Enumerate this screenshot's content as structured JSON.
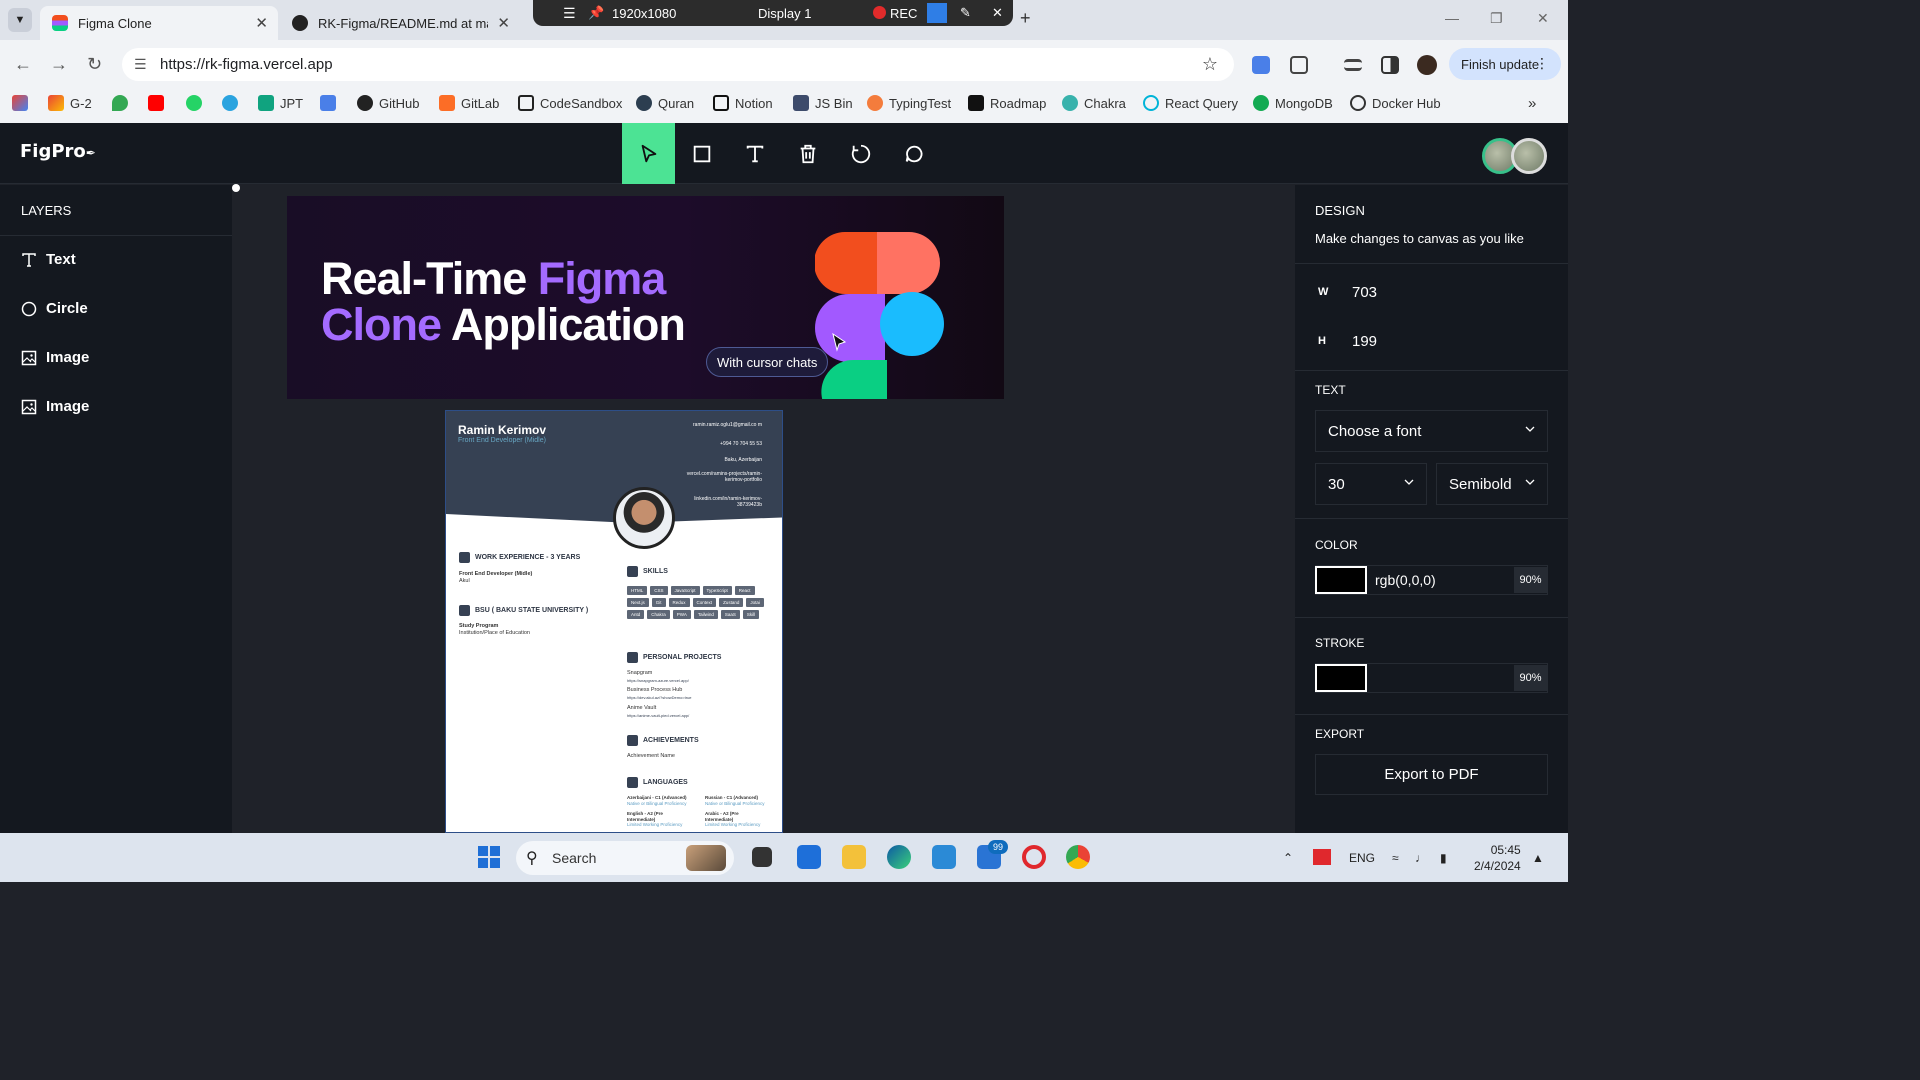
{
  "browser": {
    "tabs": [
      {
        "title": "Figma Clone",
        "active": true
      },
      {
        "title": "RK-Figma/README.md at main",
        "active": false
      }
    ],
    "recorder": {
      "resolution": "1920x1080",
      "display": "Display 1",
      "rec_label": "REC"
    },
    "url": "https://rk-figma.vercel.app",
    "finish_update": "Finish update",
    "bookmarks": [
      "G-2",
      "JPT",
      "GitHub",
      "GitLab",
      "CodeSandbox",
      "Quran",
      "Notion",
      "JS Bin",
      "TypingTest",
      "Roadmap",
      "Chakra",
      "React Query",
      "MongoDB",
      "Docker Hub"
    ]
  },
  "app": {
    "logo": "FigPro",
    "tools": [
      "select-tool",
      "rectangle-tool",
      "text-tool",
      "delete-tool",
      "reset-tool",
      "comment-tool"
    ],
    "active_tool": "select-tool"
  },
  "layers": {
    "title": "LAYERS",
    "items": [
      {
        "label": "Text",
        "icon": "text-icon"
      },
      {
        "label": "Circle",
        "icon": "circle-icon"
      },
      {
        "label": "Image",
        "icon": "image-icon"
      },
      {
        "label": "Image",
        "icon": "image-icon"
      }
    ]
  },
  "canvas": {
    "banner": {
      "line1_a": "Real-Time ",
      "line1_b": "Figma",
      "line2_a": "Clone",
      "line2_b": " Application",
      "cursor_chat": "With cursor chats"
    },
    "resume": {
      "name": "Ramin Kerimov",
      "role": "Front End Developer (Midle)",
      "contacts": [
        "ramin.ramiz.oglu1@gmail.co m",
        "+994 70 704 55 53",
        "Baku, Azerbaijan",
        "vercel.com/ramins-projects/ramin-kerimov-portfolio",
        "linkedin.com/in/ramin-kerimov-38739423b"
      ],
      "work_title": "WORK EXPERIENCE - 3 YEARS",
      "work_role": "Front End Developer (Midle)",
      "work_company": "Akul",
      "edu_title": "BSU ( BAKU STATE UNIVERSITY )",
      "edu_program": "Study Program",
      "edu_place": "Institution/Place of Education",
      "skills_title": "SKILLS",
      "skills": [
        "HTML",
        "CSS",
        "JavaScript",
        "TypeScript",
        "React",
        "Next.js",
        "Git",
        "Redux",
        "Context",
        "Zustand",
        "Jotai",
        "Antd",
        "Chakra",
        "PWA",
        "Tailwind",
        "SaaS",
        "Skill"
      ],
      "projects_title": "PERSONAL PROJECTS",
      "projects": [
        {
          "name": "Snapgram",
          "link": "https://snapgram-azure.vercel.app/"
        },
        {
          "name": "Business Process Hub",
          "link": "https://dev.akul.az/?showDemo=true"
        },
        {
          "name": "Anime Vault",
          "link": "https://anime-vault-pied.vercel.app/"
        }
      ],
      "achievements_title": "ACHIEVEMENTS",
      "achievement_name": "Achievement Name",
      "languages_title": "LANGUAGES",
      "languages": [
        {
          "name": "Azerbaijani - C1 (Advanced)",
          "level": "Native or Bilingual Proficiency"
        },
        {
          "name": "Russian - C1 (Advanced)",
          "level": "Native or Bilingual Proficiency"
        },
        {
          "name": "English - A2 (Pre Intermediate)",
          "level": "Limited Working Proficiency"
        },
        {
          "name": "Arabic - A2 (Pre Intermediate)",
          "level": "Limited Working Proficiency"
        }
      ]
    }
  },
  "design": {
    "title": "DESIGN",
    "description": "Make changes to canvas as you like",
    "w_label": "W",
    "w_value": "703",
    "h_label": "H",
    "h_value": "199",
    "text_title": "TEXT",
    "font_placeholder": "Choose a font",
    "font_size": "30",
    "font_weight": "Semibold",
    "color_title": "COLOR",
    "color_value": "rgb(0,0,0)",
    "color_opacity": "90%",
    "stroke_title": "STROKE",
    "stroke_opacity": "90%",
    "export_title": "EXPORT",
    "export_button": "Export to PDF"
  },
  "taskbar": {
    "search_placeholder": "Search",
    "mail_badge": "99",
    "lang": "ENG",
    "time": "05:45",
    "date": "2/4/2024"
  },
  "colors": {
    "accent": "#4ce394",
    "panel": "#14181f",
    "canvas": "#1f2229",
    "purple": "#a46bff"
  }
}
